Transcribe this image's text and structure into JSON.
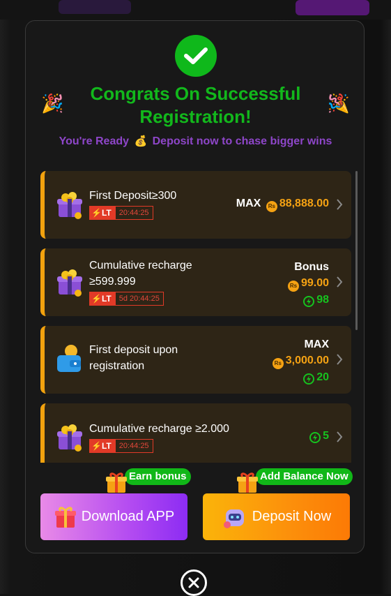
{
  "modal": {
    "title": "Congrats On Successful Registration!",
    "subtitle_prefix": "You're Ready",
    "subtitle_suffix": "Deposit now to chase bigger wins"
  },
  "rewards": [
    {
      "label": "First Deposit≥300",
      "lt": "LT",
      "timer": "20:44:25",
      "prefix": "MAX",
      "amount": "88,888.00"
    },
    {
      "label_line1": "Cumulative recharge",
      "label_line2": "≥599.999",
      "lt": "LT",
      "timer": "5d 20:44:25",
      "prefix": "Bonus",
      "amount": "99.00",
      "points": "98"
    },
    {
      "label_line1": "First deposit upon",
      "label_line2": "registration",
      "prefix": "MAX",
      "amount": "3,000.00",
      "points": "20"
    },
    {
      "label": "Cumulative recharge ≥2.000",
      "lt": "LT",
      "timer": "20:44:25",
      "points": "5"
    }
  ],
  "currency_symbol": "Rs",
  "tags": {
    "earn_bonus": "Earn bonus",
    "add_balance": "Add Balance Now"
  },
  "buttons": {
    "download": "Download APP",
    "deposit": "Deposit Now"
  },
  "colors": {
    "accent_green": "#12b81c",
    "accent_orange": "#f5a213",
    "subtitle_purple": "#8e46c9"
  }
}
